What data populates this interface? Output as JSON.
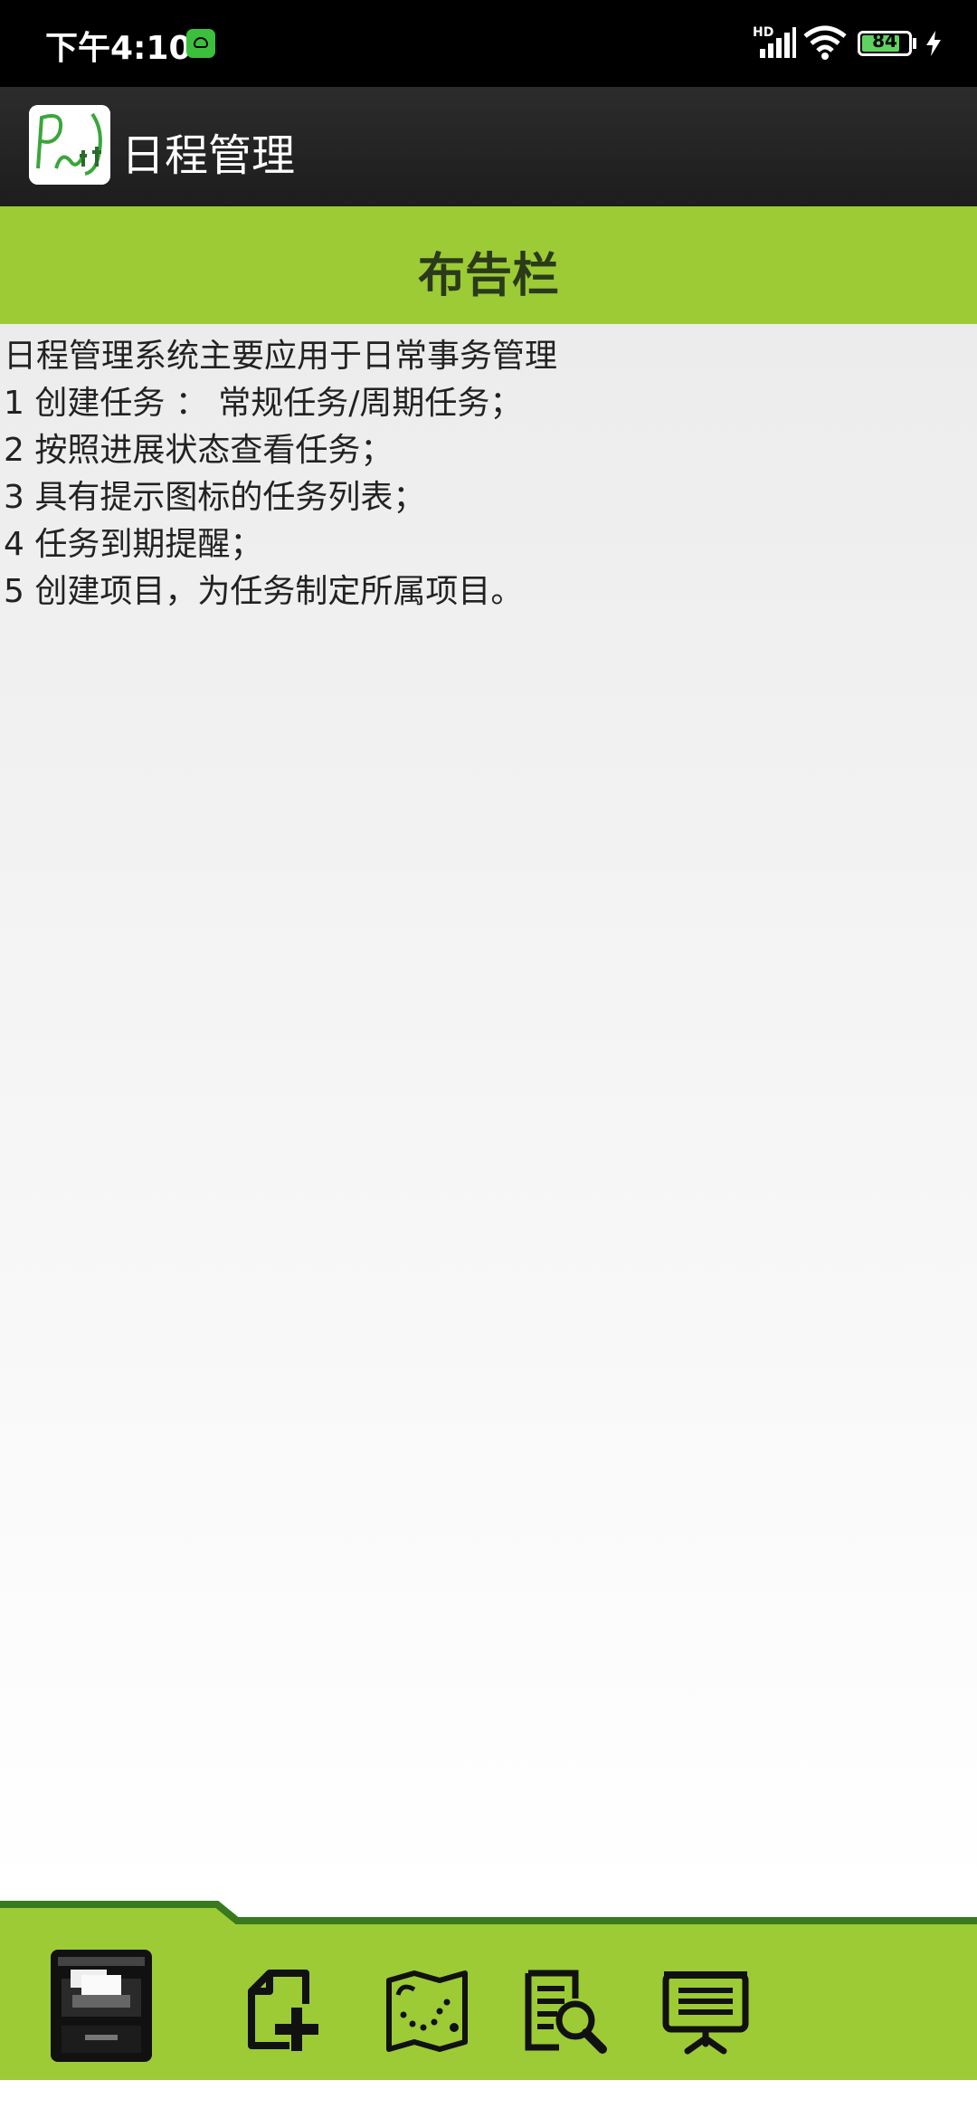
{
  "status_bar": {
    "time": "下午4:10",
    "network_label": "HD",
    "battery": "84",
    "battery_level": 0.84,
    "icons": [
      "app-notification-icon",
      "signal-icon",
      "wifi-icon",
      "battery-icon",
      "charging-icon"
    ]
  },
  "action_bar": {
    "title": "日程管理",
    "logo_icon": "app-logo-icon"
  },
  "banner": {
    "title": "布告栏"
  },
  "notice": {
    "lines": [
      "日程管理系统主要应用于日常事务管理",
      " 1 创建任务 ： 常规任务/周期任务；",
      " 2 按照进展状态查看任务；",
      " 3 具有提示图标的任务列表；",
      " 4 任务到期提醒；",
      " 5 创建项目，为任务制定所属项目。"
    ]
  },
  "bottom_nav": {
    "items": [
      {
        "icon": "file-cabinet-icon",
        "selected": true
      },
      {
        "icon": "add-document-icon",
        "selected": false
      },
      {
        "icon": "map-icon",
        "selected": false
      },
      {
        "icon": "search-document-icon",
        "selected": false
      },
      {
        "icon": "presentation-board-icon",
        "selected": false
      }
    ]
  },
  "colors": {
    "banner": "#9ccb36",
    "nav_bar": "#9ccb36",
    "nav_edge": "#3a7a1e",
    "action_bar": "#222222",
    "status_bar": "#000000"
  }
}
